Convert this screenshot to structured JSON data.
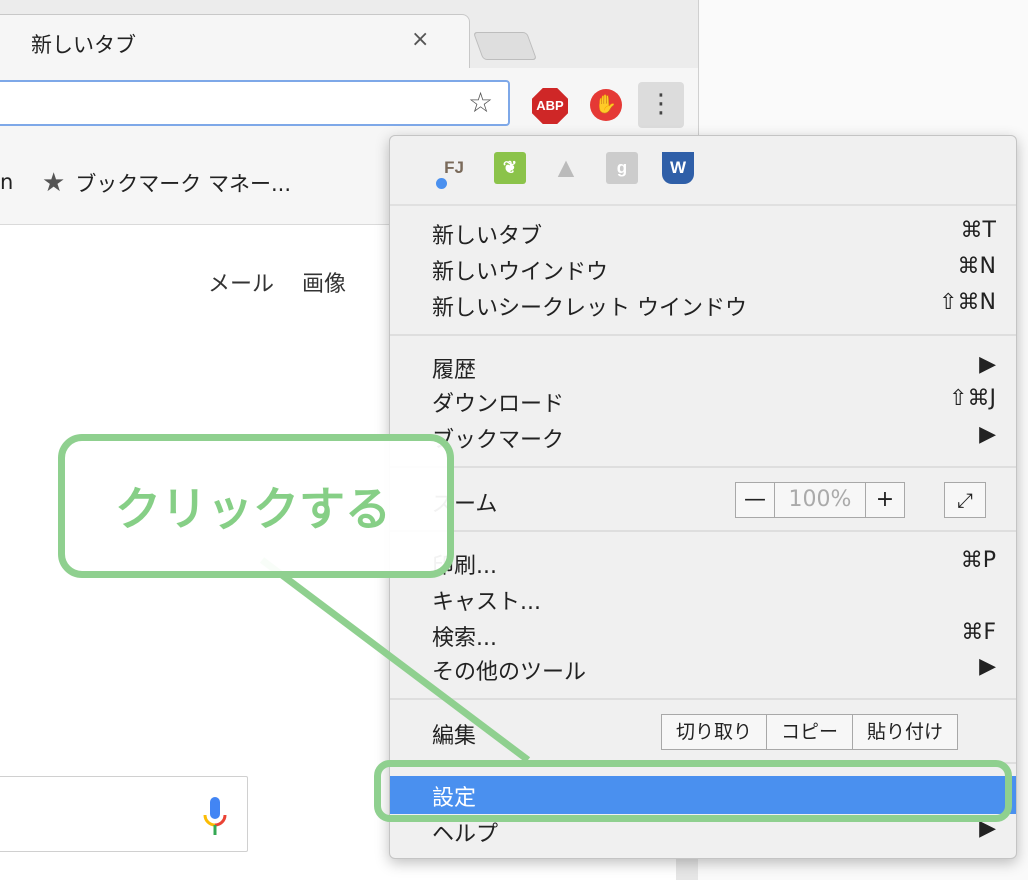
{
  "browser": {
    "tab_title": "新しいタブ",
    "tab_close": "×",
    "bookmark_partial": "n",
    "bookmark_item": "ブックマーク マネー...",
    "extensions": {
      "abp_label": "ABP"
    }
  },
  "page": {
    "links": [
      "メール",
      "画像"
    ]
  },
  "menu": {
    "extension_icons": [
      "FJ",
      "leaf",
      "drive",
      "g",
      "W"
    ],
    "group1": [
      {
        "label": "新しいタブ",
        "shortcut": "⌘T"
      },
      {
        "label": "新しいウインドウ",
        "shortcut": "⌘N"
      },
      {
        "label": "新しいシークレット ウインドウ",
        "shortcut": "⇧⌘N"
      }
    ],
    "group2": [
      {
        "label": "履歴",
        "shortcut": "▶"
      },
      {
        "label": "ダウンロード",
        "shortcut": "⇧⌘J"
      },
      {
        "label": "ブックマーク",
        "shortcut": "▶"
      }
    ],
    "zoom": {
      "label": "ズーム",
      "minus": "—",
      "value": "100%",
      "plus": "+"
    },
    "group3": [
      {
        "label": "印刷...",
        "shortcut": "⌘P"
      },
      {
        "label": "キャスト...",
        "shortcut": ""
      },
      {
        "label": "検索...",
        "shortcut": "⌘F"
      },
      {
        "label": "その他のツール",
        "shortcut": "▶"
      }
    ],
    "edit": {
      "label": "編集",
      "cut": "切り取り",
      "copy": "コピー",
      "paste": "貼り付け"
    },
    "settings": "設定",
    "help": {
      "label": "ヘルプ",
      "shortcut": "▶"
    }
  },
  "annotation": {
    "callout_text": "クリックする",
    "color": "#8fd08f"
  }
}
